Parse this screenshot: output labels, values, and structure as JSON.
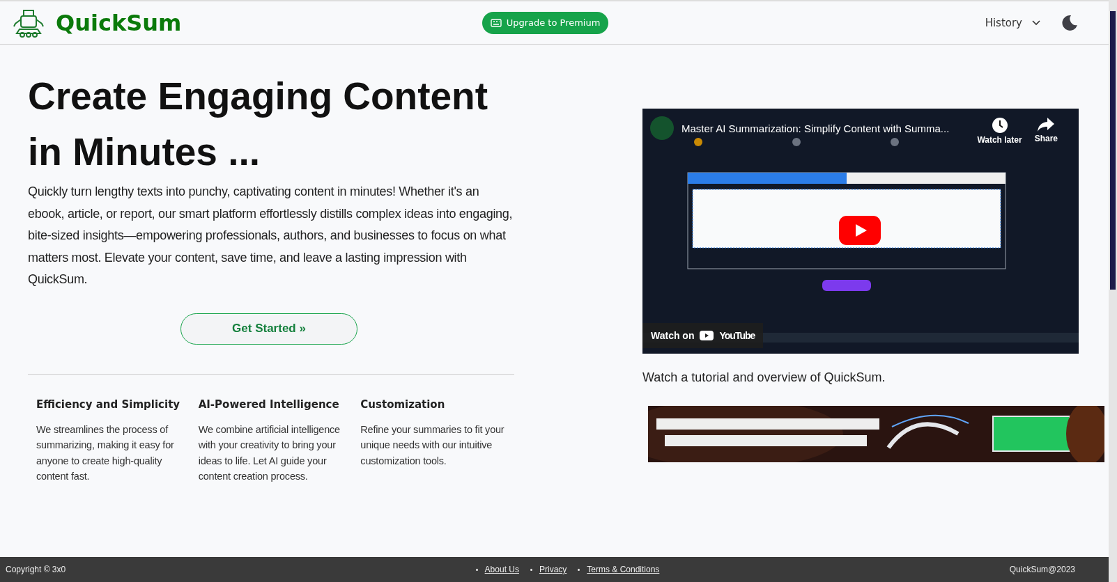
{
  "header": {
    "brand": "QuickSum",
    "upgrade_button": "Upgrade to Premium",
    "history_menu": "History"
  },
  "hero": {
    "title": "Create Engaging Content in Minutes ...",
    "text": "Quickly  turn lengthy texts into punchy, captivating content in minutes! Whether it's an ebook, article, or report, our smart platform effortlessly distills complex ideas into engaging, bite-sized insights—empowering professionals, authors, and businesses to focus on what matters most. Elevate your content, save time, and leave a lasting impression with QuickSum.",
    "button": "Get Started »"
  },
  "features": [
    {
      "title": "Efficiency and Simplicity",
      "text": "We streamlines the process of summarizing, making it easy for anyone to create high-quality content fast."
    },
    {
      "title": "AI-Powered Intelligence",
      "text": "We combine artificial intelligence with your creativity to bring your ideas to life. Let AI guide your content creation process."
    },
    {
      "title": "Customization",
      "text": "Refine your summaries to fit your unique needs with our intuitive customization tools."
    }
  ],
  "video": {
    "kind": "picture",
    "title": "Master AI Summarization: Simplify Content with Summa...",
    "watch_later": "Watch later",
    "share": "Share",
    "watch_on": "Watch on",
    "platform": "YouTube"
  },
  "video_caption": "Watch a tutorial and overview of QuickSum.",
  "footer": {
    "copyright": "Copyright © 3x0",
    "links": [
      "About Us",
      "Privacy",
      "Terms & Conditions"
    ],
    "right": "QuickSum@2023"
  }
}
